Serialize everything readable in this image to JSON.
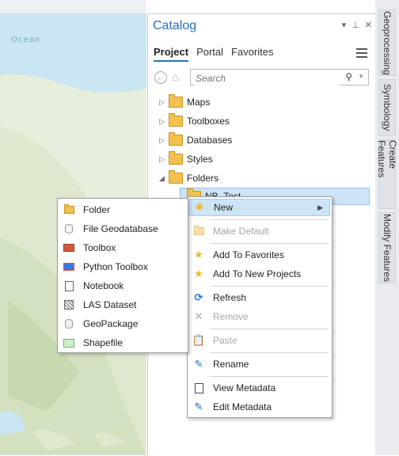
{
  "map": {
    "ocean_label": "Ocean"
  },
  "catalog": {
    "title": "Catalog",
    "tools": {
      "dropdown": "▾",
      "pin": "⊥",
      "close": "✕"
    },
    "tabs": [
      {
        "label": "Project",
        "active": true
      },
      {
        "label": "Portal",
        "active": false
      },
      {
        "label": "Favorites",
        "active": false
      }
    ],
    "search_placeholder": "Search",
    "tree": [
      {
        "label": "Maps",
        "expanded": false
      },
      {
        "label": "Toolboxes",
        "expanded": false
      },
      {
        "label": "Databases",
        "expanded": false
      },
      {
        "label": "Styles",
        "expanded": false
      },
      {
        "label": "Folders",
        "expanded": true
      },
      {
        "label": "NB_Test",
        "expanded": false,
        "selected": true
      }
    ]
  },
  "dock": {
    "tabs": [
      "Geoprocessing",
      "Symbology",
      "Create Features",
      "Modify Features"
    ]
  },
  "context_menu": {
    "items": [
      {
        "label": "New",
        "icon": "new-sparkle-icon",
        "highlighted": true,
        "submenu": true
      },
      {
        "label": "Make Default",
        "icon": "make-default-folder-icon",
        "disabled": true
      },
      {
        "label": "Add To Favorites",
        "icon": "star-icon"
      },
      {
        "label": "Add To New Projects",
        "icon": "star-icon"
      },
      {
        "label": "Refresh",
        "icon": "refresh-icon"
      },
      {
        "label": "Remove",
        "icon": "remove-x-icon",
        "disabled": true
      },
      {
        "label": "Paste",
        "icon": "paste-icon",
        "disabled": true
      },
      {
        "label": "Rename",
        "icon": "rename-pencil-icon"
      },
      {
        "label": "View Metadata",
        "icon": "view-metadata-icon"
      },
      {
        "label": "Edit Metadata",
        "icon": "edit-metadata-icon"
      }
    ]
  },
  "new_submenu": {
    "items": [
      {
        "label": "Folder",
        "icon": "folder-icon"
      },
      {
        "label": "File Geodatabase",
        "icon": "geodatabase-icon"
      },
      {
        "label": "Toolbox",
        "icon": "toolbox-icon"
      },
      {
        "label": "Python Toolbox",
        "icon": "python-toolbox-icon"
      },
      {
        "label": "Notebook",
        "icon": "notebook-icon"
      },
      {
        "label": "LAS Dataset",
        "icon": "las-dataset-icon"
      },
      {
        "label": "GeoPackage",
        "icon": "geopackage-icon"
      },
      {
        "label": "Shapefile",
        "icon": "shapefile-icon"
      }
    ]
  },
  "colors": {
    "accent": "#2a6ebb",
    "highlight": "#cde4f7",
    "star": "#e8b923"
  }
}
